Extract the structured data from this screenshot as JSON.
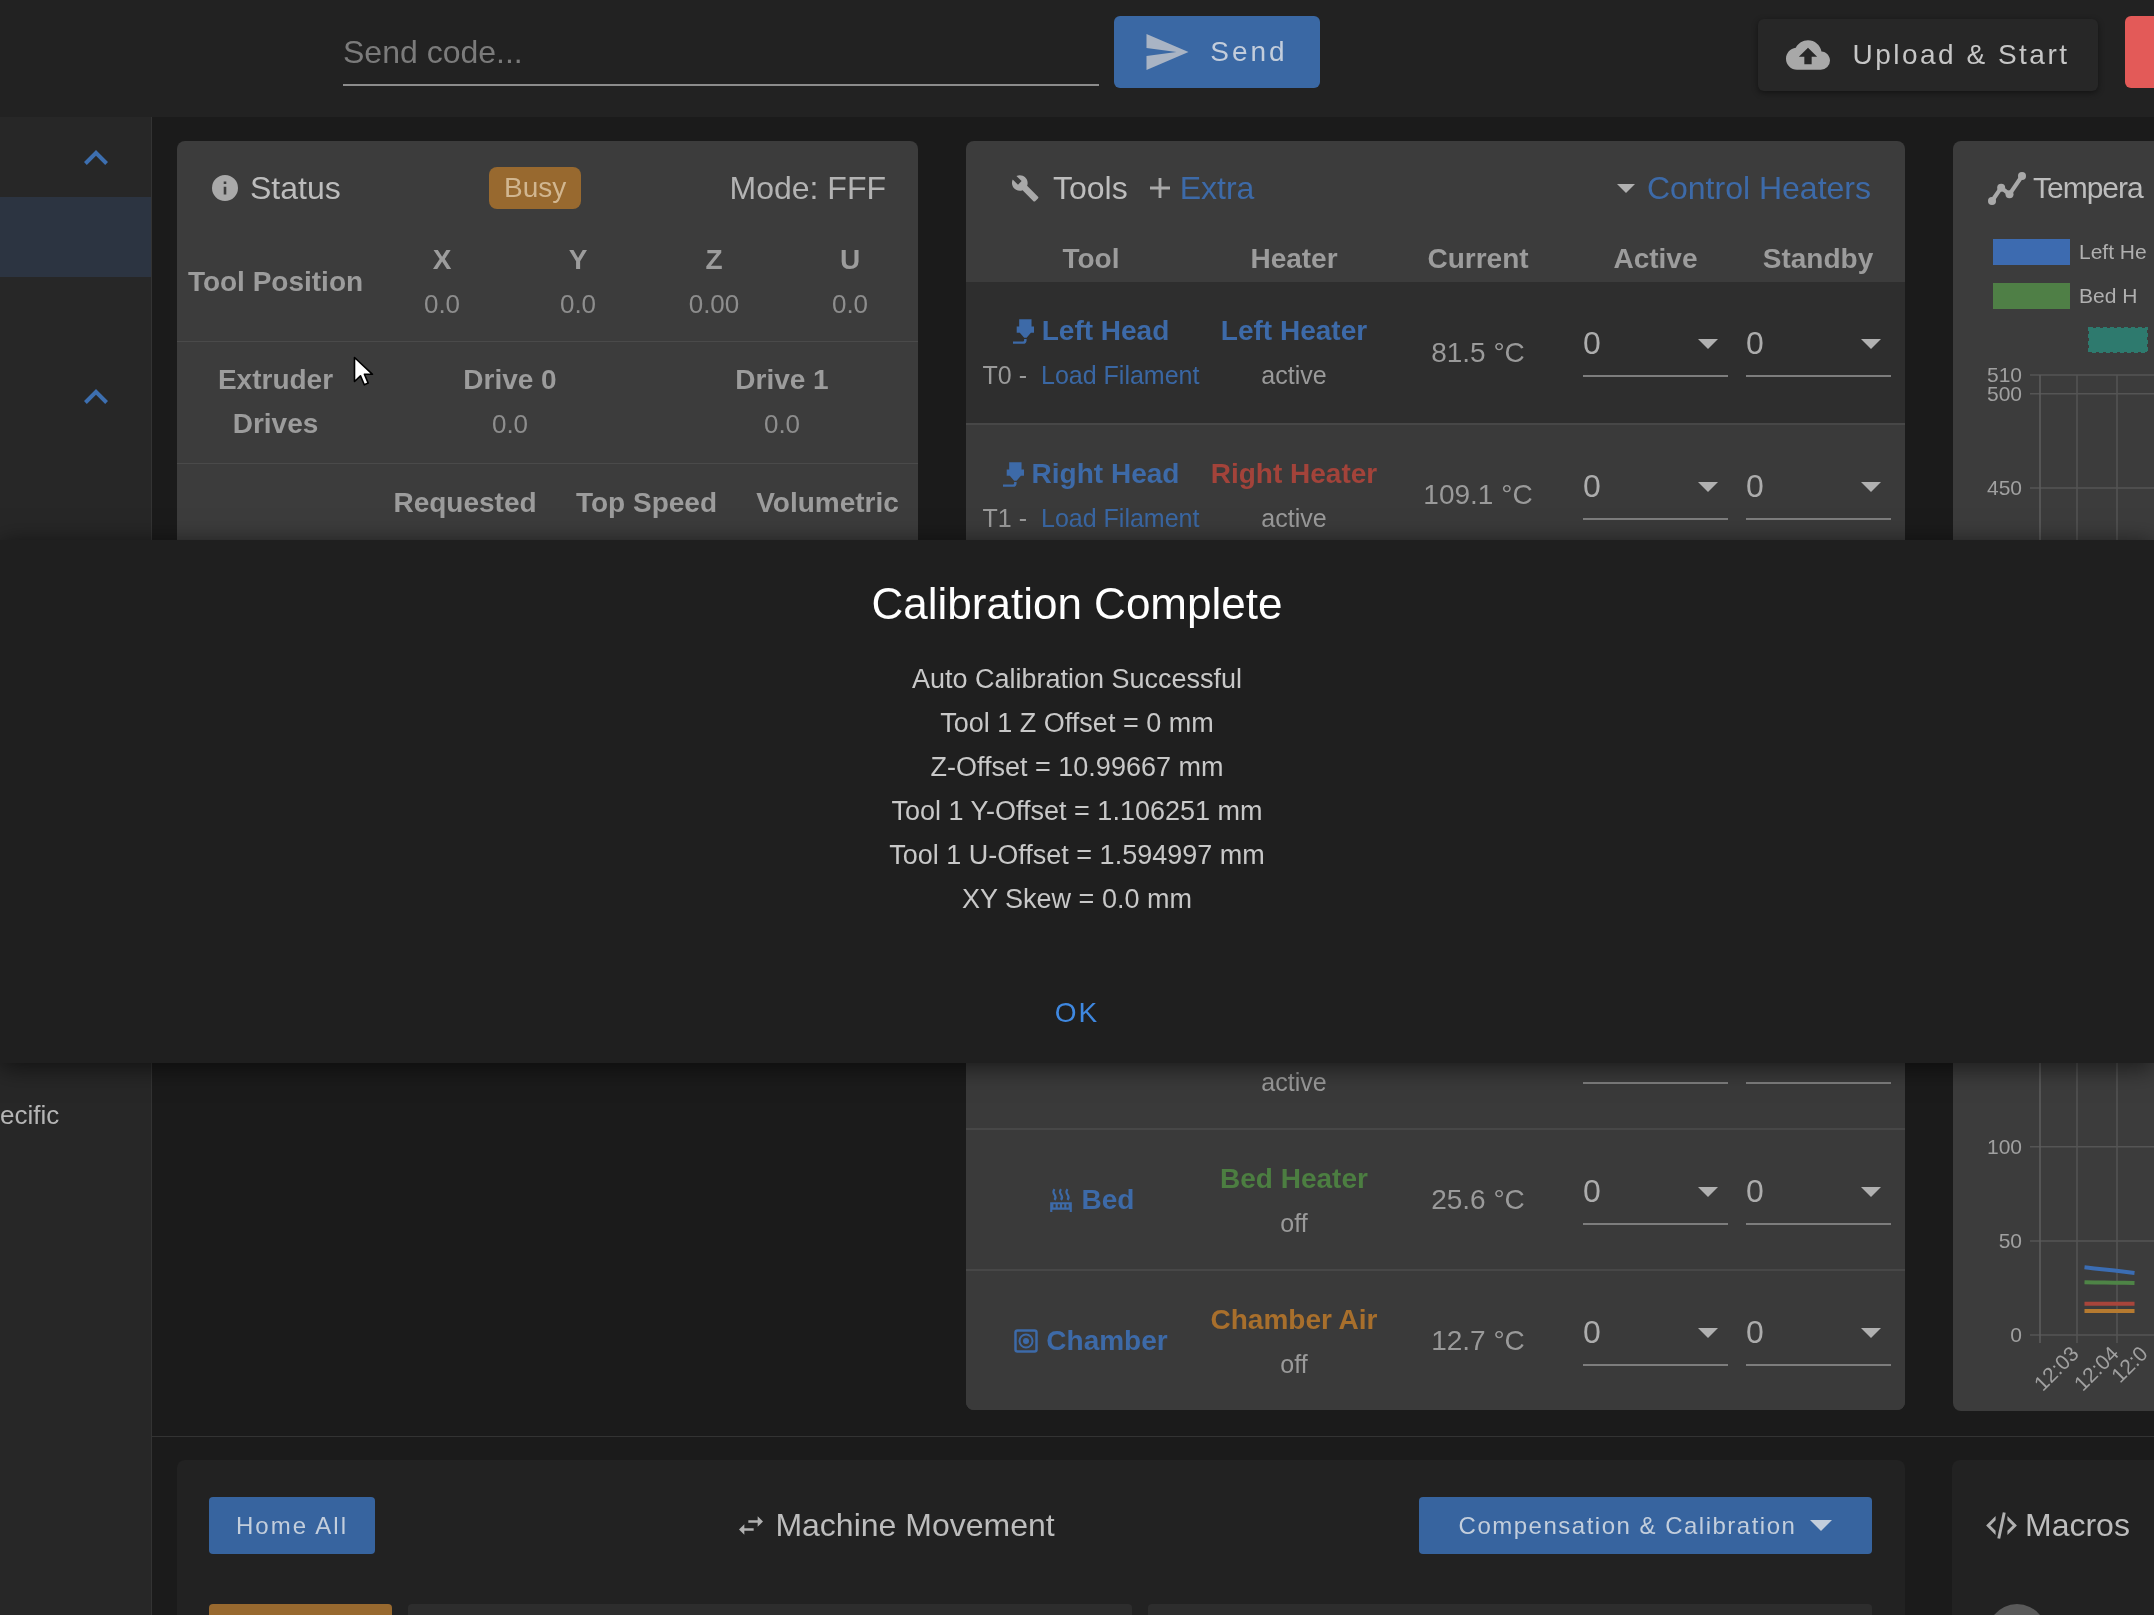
{
  "top_bar": {
    "code_input": {
      "placeholder": "Send code..."
    },
    "send_button": "Send",
    "upload_button": "Upload & Start"
  },
  "sidebar": {
    "items": [
      {
        "kind": "group",
        "expanded": true
      },
      {
        "kind": "item",
        "selected": true
      },
      {
        "kind": "group",
        "expanded": true
      }
    ],
    "lower_items": [
      {
        "label": "ecific",
        "selected": false
      }
    ]
  },
  "status_card": {
    "title": "Status",
    "badge": "Busy",
    "mode": "Mode: FFF",
    "tool_position": {
      "label": "Tool Position",
      "axes": [
        {
          "name": "X",
          "value": "0.0"
        },
        {
          "name": "Y",
          "value": "0.0"
        },
        {
          "name": "Z",
          "value": "0.00"
        },
        {
          "name": "U",
          "value": "0.0"
        }
      ]
    },
    "extruder_drives": {
      "label": "Extruder Drives",
      "drives": [
        {
          "name": "Drive 0",
          "value": "0.0"
        },
        {
          "name": "Drive 1",
          "value": "0.0"
        }
      ]
    },
    "speeds": {
      "columns": [
        "Requested",
        "Top Speed",
        "Volumetric"
      ]
    }
  },
  "tools_card": {
    "title": "Tools",
    "extra_button": "Extra",
    "control_heaters_button": "Control Heaters",
    "columns": [
      "Tool",
      "Heater",
      "Current",
      "Active",
      "Standby"
    ],
    "rows": [
      {
        "kind": "tool",
        "selected": true,
        "name": "Left Head",
        "number": "T0 -",
        "load_link": "Load Filament",
        "heater": {
          "name": "Left Heater",
          "color": "#3d6aa8"
        },
        "heater_state": "active",
        "current": "81.5 °C",
        "active": "0",
        "standby": "0"
      },
      {
        "kind": "tool",
        "selected": false,
        "name": "Right Head",
        "number": "T1 -",
        "load_link": "Load Filament",
        "heater": {
          "name": "Right Heater",
          "color": "#a3433a"
        },
        "heater_state": "active",
        "current": "109.1 °C",
        "active": "0",
        "standby": "0"
      },
      {
        "kind": "partial",
        "heater_state": "active"
      },
      {
        "kind": "bed",
        "name": "Bed",
        "heater": {
          "name": "Bed Heater",
          "color": "#4c7e41"
        },
        "heater_state": "off",
        "current": "25.6 °C",
        "active": "0",
        "standby": "0"
      },
      {
        "kind": "chamber",
        "name": "Chamber",
        "heater": {
          "name": "Chamber Air",
          "color": "#a86f2c"
        },
        "heater_state": "off",
        "current": "12.7 °C",
        "active": "0",
        "standby": "0"
      }
    ]
  },
  "temperature_card": {
    "title": "Tempera",
    "legend": [
      {
        "label": "Left He",
        "color": "#3d6bb0"
      },
      {
        "label": "Bed H",
        "color": "#4f7f46"
      },
      {
        "color": "#2e7a6e"
      }
    ],
    "chart_data": {
      "type": "line",
      "grid": true,
      "categories": [
        "12:03",
        null,
        null,
        null,
        "12:04",
        null,
        null,
        null,
        "12:0"
      ],
      "ylim": [
        0,
        510
      ],
      "yticks": [
        0,
        50,
        100,
        450,
        500,
        510
      ],
      "series": [
        {
          "color": "#3b6db3",
          "values": [
            null,
            null,
            null,
            36.0,
            35.4,
            34.8,
            34.2,
            33.6,
            33.0
          ]
        },
        {
          "color": "#4e8446",
          "values": [
            null,
            null,
            null,
            28.0,
            27.9,
            27.9,
            27.8,
            27.8,
            27.7
          ]
        },
        {
          "color": "#a8453b",
          "values": [
            null,
            null,
            null,
            16.6,
            16.6,
            16.6,
            16.6,
            16.6,
            16.6
          ]
        },
        {
          "color": "#b57a30",
          "values": [
            null,
            null,
            null,
            12.8,
            12.8,
            12.8,
            12.8,
            12.8,
            12.8
          ]
        }
      ]
    }
  },
  "movement_card": {
    "home_button": "Home All",
    "title": "Machine Movement",
    "compensation_button": "Compensation & Calibration"
  },
  "macros_card": {
    "title": "Macros"
  },
  "dialog": {
    "title": "Calibration Complete",
    "lines": [
      "Auto Calibration Successful",
      "Tool 1 Z Offset = 0 mm",
      "Z-Offset = 10.99667 mm",
      "Tool 1 Y-Offset = 1.106251 mm",
      "Tool 1 U-Offset = 1.594997 mm",
      "XY Skew = 0.0 mm"
    ],
    "ok_button": "OK"
  }
}
